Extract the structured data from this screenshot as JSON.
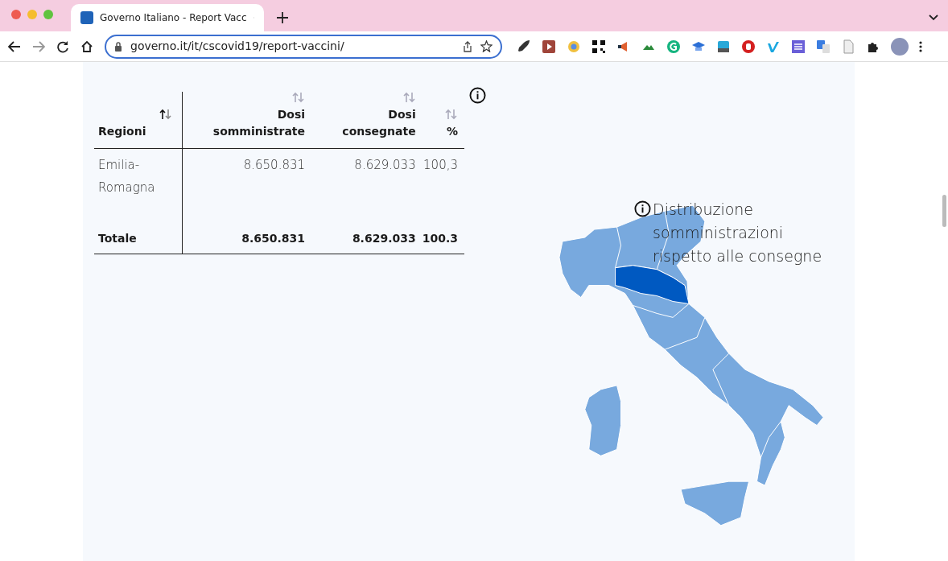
{
  "browser": {
    "tab_title": "Governo Italiano - Report Vacc",
    "url": "governo.it/it/cscovid19/report-vaccini/"
  },
  "table": {
    "columns": [
      {
        "label": "Regioni",
        "sort_active": true
      },
      {
        "label": "Dosi somministrate",
        "sort_active": false
      },
      {
        "label": "Dosi consegnate",
        "sort_active": false
      },
      {
        "label": "%",
        "sort_active": false
      }
    ],
    "rows": [
      {
        "cells": [
          "Emilia-Romagna",
          "8.650.831",
          "8.629.033",
          "100,3"
        ]
      }
    ],
    "total": [
      "Totale",
      "8.650.831",
      "8.629.033",
      "100.3"
    ]
  },
  "map": {
    "legend": "Distribuzione somministrazioni rispetto alle consegne"
  }
}
